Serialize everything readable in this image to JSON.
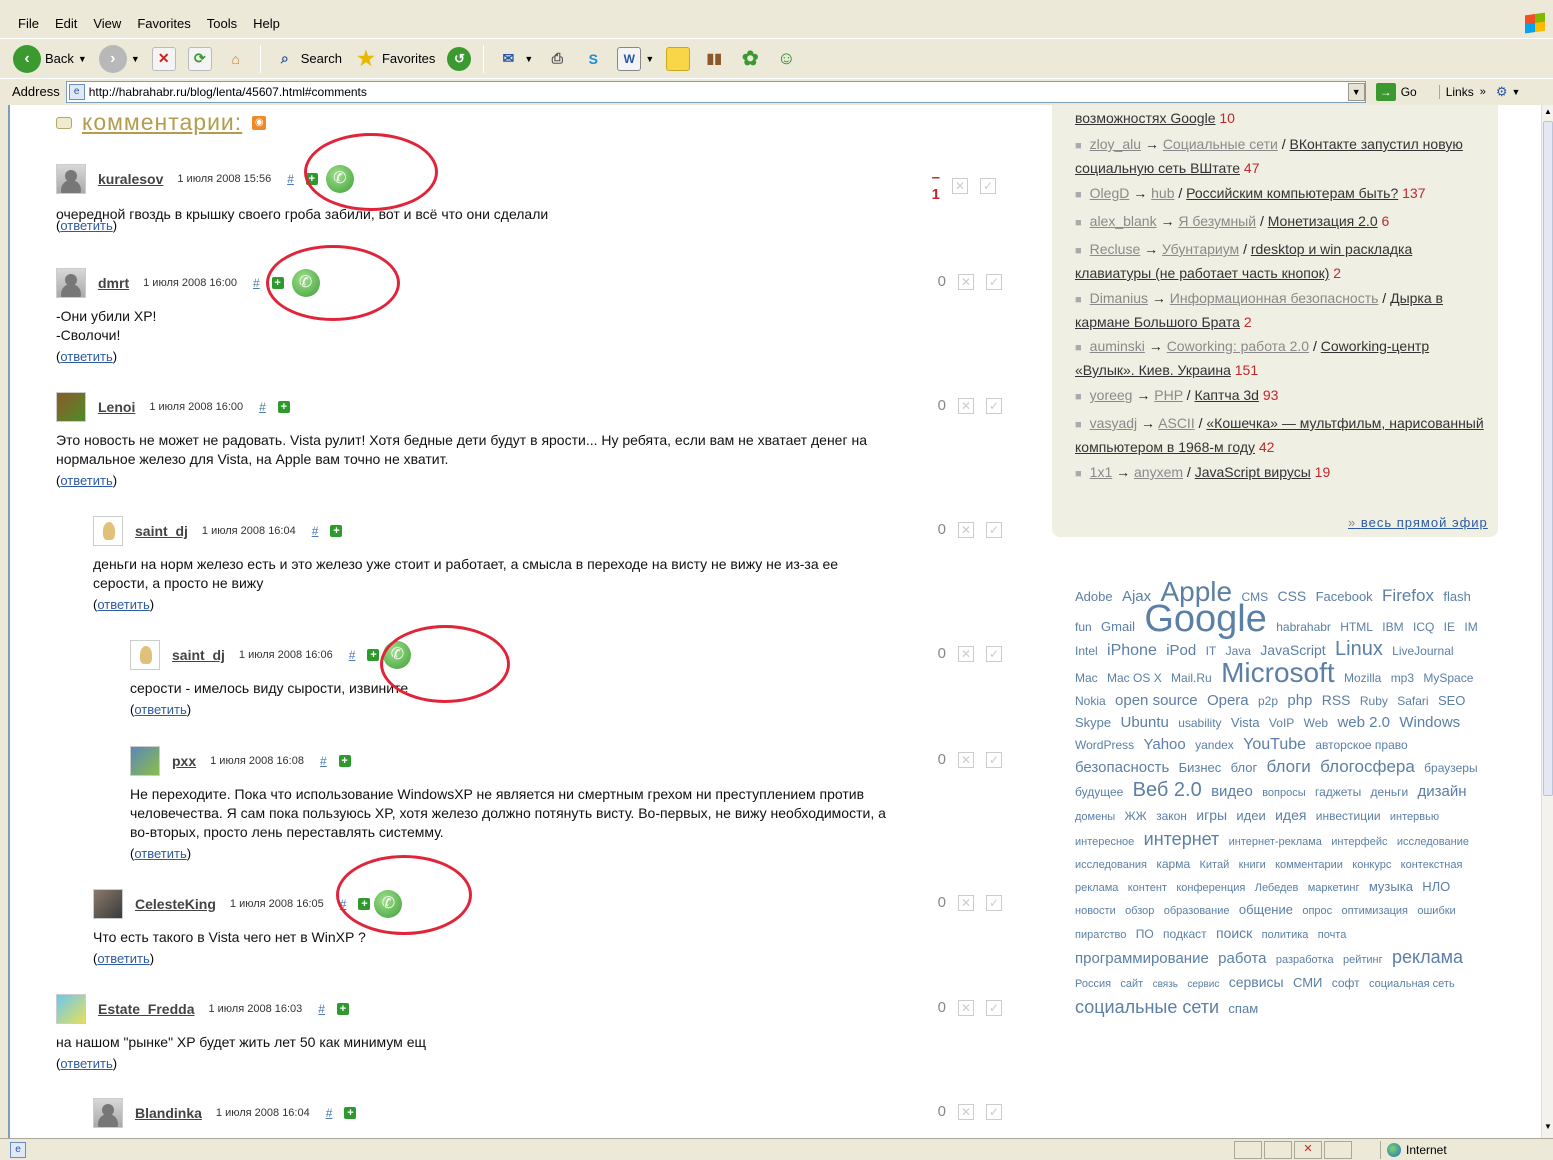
{
  "menu": [
    "File",
    "Edit",
    "View",
    "Favorites",
    "Tools",
    "Help"
  ],
  "toolbar": {
    "back": "Back",
    "search": "Search",
    "favorites": "Favorites"
  },
  "address": {
    "label": "Address",
    "url": "http://habrahabr.ru/blog/lenta/45607.html#comments",
    "go": "Go",
    "links": "Links"
  },
  "status": {
    "zone": "Internet"
  },
  "comments_title": "комментарии:",
  "reply_label": "ответить",
  "hash": "#",
  "comments": [
    {
      "user": "kuralesov",
      "date": "1 июля 2008 15:56",
      "score": "–1",
      "body": [
        "очередной гвоздь в крышку своего гроба забили, вот и всё что они сделали"
      ]
    },
    {
      "user": "dmrt",
      "date": "1 июля 2008 16:00",
      "score": "0",
      "body": [
        "-Они убили XP!",
        "-Сволочи!"
      ]
    },
    {
      "user": "Lenoi",
      "date": "1 июля 2008 16:00",
      "score": "0",
      "body": [
        "Это новость не может не радовать. Vista рулит! Хотя бедные дети будут в ярости... Ну ребята, если вам не хватает денег на",
        "нормальное железо для Vista, на Apple вам точно не хватит."
      ]
    },
    {
      "user": "saint_dj",
      "date": "1 июля 2008 16:04",
      "score": "0",
      "body": [
        "деньги на норм железо есть и это железо уже стоит и работает, а смысла в переходе на висту не вижу не из-за ее",
        "серости, а просто не вижу"
      ]
    },
    {
      "user": "saint_dj",
      "date": "1 июля 2008 16:06",
      "score": "0",
      "body": [
        "серости - имелось виду сырости, извините"
      ]
    },
    {
      "user": "pxx",
      "date": "1 июля 2008 16:08",
      "score": "0",
      "body": [
        "Не переходите. Пока что использование WindowsXP не является ни смертным грехом ни преступлением против",
        "человечества. Я сам пока пользуюсь XP, хотя железо должно потянуть висту. Во-первых, не вижу необходимости, а",
        "во-вторых, просто лень переставлять системму."
      ]
    },
    {
      "user": "CelesteKing",
      "date": "1 июля 2008 16:05",
      "score": "0",
      "body": [
        "Что есть такого в Vista чего нет в WinXP ?"
      ]
    },
    {
      "user": "Estate_Fredda",
      "date": "1 июля 2008 16:03",
      "score": "0",
      "body": [
        "на нашом \"рынке\" XP будет жить лет 50 как минимум ещ"
      ]
    },
    {
      "user": "Blandinka",
      "date": "1 июля 2008 16:04",
      "score": "0",
      "body": []
    }
  ],
  "live": {
    "top_partial": {
      "post": "возможностях Google",
      "count": "10"
    },
    "items": [
      {
        "user": "zloy_alu",
        "blog": "Социальные сети",
        "post": "ВКонтакте запустил новую социальную сеть ВШтате",
        "count": "47"
      },
      {
        "user": "OlegD",
        "blog": "hub",
        "post": "Российским компьютерам быть?",
        "count": "137"
      },
      {
        "user": "alex_blank",
        "blog": "Я безумный",
        "post": "Монетизация 2.0",
        "count": "6"
      },
      {
        "user": "Recluse",
        "blog": "Убунтариум",
        "post": "rdesktop и win раскладка клавиатуры (не работает часть кнопок)",
        "count": "2"
      },
      {
        "user": "Dimanius",
        "blog": "Информационная безопасность",
        "post": "Дырка в кармане Большого Брата",
        "count": "2"
      },
      {
        "user": "auminski",
        "blog": "Coworking: работа 2.0",
        "post": "Coworking-центр «Вулык». Киев. Украина",
        "count": "151"
      },
      {
        "user": "yoreeg",
        "blog": "PHP",
        "post": "Каптча 3d",
        "count": "93"
      },
      {
        "user": "vasyadj",
        "blog": "ASCII",
        "post": "«Кошечка» — мультфильм, нарисованный компьютером в 1968-м году",
        "count": "42"
      },
      {
        "user": "1x1",
        "blog": "anyxem",
        "post": "JavaScript вирусы",
        "count": "19"
      }
    ],
    "more": "весь прямой эфир",
    "more_prefix": "»"
  },
  "tags": [
    {
      "t": "Adobe",
      "s": 13
    },
    {
      "t": "Ajax",
      "s": 15
    },
    {
      "t": "Apple",
      "s": 28
    },
    {
      "t": "CMS",
      "s": 12
    },
    {
      "t": "CSS",
      "s": 14
    },
    {
      "t": "Facebook",
      "s": 13
    },
    {
      "t": "Firefox",
      "s": 17
    },
    {
      "t": "flash",
      "s": 13
    },
    {
      "t": "fun",
      "s": 12
    },
    {
      "t": "Gmail",
      "s": 13
    },
    {
      "t": "Google",
      "s": 38
    },
    {
      "t": "habrahabr",
      "s": 12
    },
    {
      "t": "HTML",
      "s": 12
    },
    {
      "t": "IBM",
      "s": 12
    },
    {
      "t": "ICQ",
      "s": 12
    },
    {
      "t": "IE",
      "s": 12
    },
    {
      "t": "IM",
      "s": 12
    },
    {
      "t": "Intel",
      "s": 12
    },
    {
      "t": "iPhone",
      "s": 16
    },
    {
      "t": "iPod",
      "s": 15
    },
    {
      "t": "IT",
      "s": 12
    },
    {
      "t": "Java",
      "s": 12
    },
    {
      "t": "JavaScript",
      "s": 14
    },
    {
      "t": "Linux",
      "s": 20
    },
    {
      "t": "LiveJournal",
      "s": 12
    },
    {
      "t": "Mac",
      "s": 12
    },
    {
      "t": "Mac OS X",
      "s": 12
    },
    {
      "t": "Mail.Ru",
      "s": 12
    },
    {
      "t": "Microsoft",
      "s": 28
    },
    {
      "t": "Mozilla",
      "s": 12
    },
    {
      "t": "mp3",
      "s": 12
    },
    {
      "t": "MySpace",
      "s": 12
    },
    {
      "t": "Nokia",
      "s": 12
    },
    {
      "t": "open source",
      "s": 15
    },
    {
      "t": "Opera",
      "s": 15
    },
    {
      "t": "p2p",
      "s": 12
    },
    {
      "t": "php",
      "s": 15
    },
    {
      "t": "RSS",
      "s": 14
    },
    {
      "t": "Ruby",
      "s": 12
    },
    {
      "t": "Safari",
      "s": 12
    },
    {
      "t": "SEO",
      "s": 13
    },
    {
      "t": "Skype",
      "s": 13
    },
    {
      "t": "Ubuntu",
      "s": 15
    },
    {
      "t": "usability",
      "s": 12
    },
    {
      "t": "Vista",
      "s": 13
    },
    {
      "t": "VoIP",
      "s": 12
    },
    {
      "t": "Web",
      "s": 12
    },
    {
      "t": "web 2.0",
      "s": 15
    },
    {
      "t": "Windows",
      "s": 15
    },
    {
      "t": "WordPress",
      "s": 12
    },
    {
      "t": "Yahoo",
      "s": 15
    },
    {
      "t": "yandex",
      "s": 12
    },
    {
      "t": "YouTube",
      "s": 16
    },
    {
      "t": "авторское право",
      "s": 12
    },
    {
      "t": "безопасность",
      "s": 15
    },
    {
      "t": "Бизнес",
      "s": 13
    },
    {
      "t": "блог",
      "s": 13
    },
    {
      "t": "блоги",
      "s": 17
    },
    {
      "t": "блогосфера",
      "s": 17
    },
    {
      "t": "браузеры",
      "s": 12
    },
    {
      "t": "будущее",
      "s": 12
    },
    {
      "t": "Веб 2.0",
      "s": 20
    },
    {
      "t": "видео",
      "s": 15
    },
    {
      "t": "вопросы",
      "s": 11
    },
    {
      "t": "гаджеты",
      "s": 12
    },
    {
      "t": "деньги",
      "s": 12
    },
    {
      "t": "дизайн",
      "s": 15
    },
    {
      "t": "домены",
      "s": 11
    },
    {
      "t": "ЖЖ",
      "s": 12
    },
    {
      "t": "закон",
      "s": 12
    },
    {
      "t": "игры",
      "s": 14
    },
    {
      "t": "идеи",
      "s": 13
    },
    {
      "t": "идея",
      "s": 14
    },
    {
      "t": "инвестиции",
      "s": 12
    },
    {
      "t": "интервью",
      "s": 11
    },
    {
      "t": "интересное",
      "s": 11
    },
    {
      "t": "интернет",
      "s": 18
    },
    {
      "t": "интернет-реклама",
      "s": 11
    },
    {
      "t": "интерфейс",
      "s": 11
    },
    {
      "t": "исследование",
      "s": 11
    },
    {
      "t": "исследования",
      "s": 11
    },
    {
      "t": "карма",
      "s": 12
    },
    {
      "t": "Китай",
      "s": 11
    },
    {
      "t": "книги",
      "s": 11
    },
    {
      "t": "комментарии",
      "s": 11
    },
    {
      "t": "конкурс",
      "s": 11
    },
    {
      "t": "контекстная реклама",
      "s": 11
    },
    {
      "t": "контент",
      "s": 11
    },
    {
      "t": "конференция",
      "s": 11
    },
    {
      "t": "Лебедев",
      "s": 11
    },
    {
      "t": "маркетинг",
      "s": 11
    },
    {
      "t": "музыка",
      "s": 13
    },
    {
      "t": "НЛО",
      "s": 13
    },
    {
      "t": "новости",
      "s": 11
    },
    {
      "t": "обзор",
      "s": 11
    },
    {
      "t": "образование",
      "s": 11
    },
    {
      "t": "общение",
      "s": 13
    },
    {
      "t": "опрос",
      "s": 11
    },
    {
      "t": "оптимизация",
      "s": 11
    },
    {
      "t": "ошибки",
      "s": 11
    },
    {
      "t": "пиратство",
      "s": 11
    },
    {
      "t": "ПО",
      "s": 12
    },
    {
      "t": "подкаст",
      "s": 12
    },
    {
      "t": "поиск",
      "s": 14
    },
    {
      "t": "политика",
      "s": 11
    },
    {
      "t": "почта",
      "s": 11
    },
    {
      "t": "программирование",
      "s": 15
    },
    {
      "t": "работа",
      "s": 15
    },
    {
      "t": "разработка",
      "s": 11
    },
    {
      "t": "рейтинг",
      "s": 11
    },
    {
      "t": "реклама",
      "s": 18
    },
    {
      "t": "Россия",
      "s": 11
    },
    {
      "t": "сайт",
      "s": 11
    },
    {
      "t": "связь",
      "s": 10
    },
    {
      "t": "сервис",
      "s": 10
    },
    {
      "t": "сервисы",
      "s": 14
    },
    {
      "t": "СМИ",
      "s": 13
    },
    {
      "t": "софт",
      "s": 12
    },
    {
      "t": "социальная сеть",
      "s": 11
    },
    {
      "t": "социальные сети",
      "s": 18
    },
    {
      "t": "спам",
      "s": 13
    }
  ]
}
